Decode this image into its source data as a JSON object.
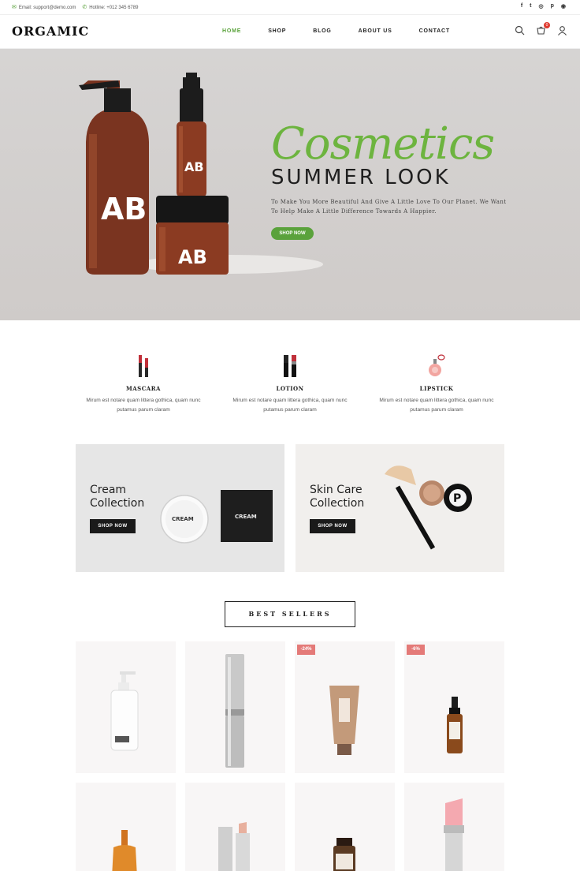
{
  "topbar": {
    "email": "Email: support@demo.com",
    "hotline": "Hotline: +012 345 6789",
    "socials": [
      "facebook-icon",
      "twitter-icon",
      "instagram-icon",
      "pinterest-icon",
      "rss-icon"
    ],
    "social_glyphs": [
      "f",
      "t",
      "◎",
      "p",
      "◉"
    ]
  },
  "header": {
    "logo": "ORGAMIC",
    "nav": [
      "HOME",
      "SHOP",
      "BLOG",
      "ABOUT US",
      "CONTACT"
    ],
    "active_nav": "HOME",
    "cart_count": "0"
  },
  "hero": {
    "script_text": "Cosmetics",
    "title": "SUMMER LOOK",
    "description": "To Make You More Beautiful And Give A Little Love To Our Planet. We Want To Help Make A Little Difference Towards A Happier.",
    "button": "SHOP NOW",
    "bottle_label": "AB"
  },
  "categories": [
    {
      "title": "MASCARA",
      "text": "Mirum est notare quam littera gothica, quam nunc putamus parum claram",
      "icon": "mascara-icon"
    },
    {
      "title": "LOTION",
      "text": "Mirum est notare quam littera gothica, quam nunc putamus parum claram",
      "icon": "lotion-icon"
    },
    {
      "title": "LIPSTICK",
      "text": "Mirum est notare quam littera gothica, quam nunc putamus parum claram",
      "icon": "perfume-icon"
    }
  ],
  "banners": [
    {
      "title_line1": "Cream",
      "title_line2": "Collection",
      "button": "SHOP NOW",
      "jar_label": "CREAM"
    },
    {
      "title_line1": "Skin Care",
      "title_line2": "Collection",
      "button": "SHOP NOW"
    }
  ],
  "best_sellers": {
    "heading": "BEST SELLERS",
    "products": [
      {
        "discount": ""
      },
      {
        "discount": ""
      },
      {
        "discount": "-24%"
      },
      {
        "discount": "-6%"
      },
      {
        "discount": ""
      },
      {
        "discount": ""
      },
      {
        "discount": ""
      },
      {
        "discount": ""
      }
    ]
  },
  "colors": {
    "accent": "#5aa23b",
    "discount": "#e47a78",
    "dark": "#1a1a1a"
  }
}
